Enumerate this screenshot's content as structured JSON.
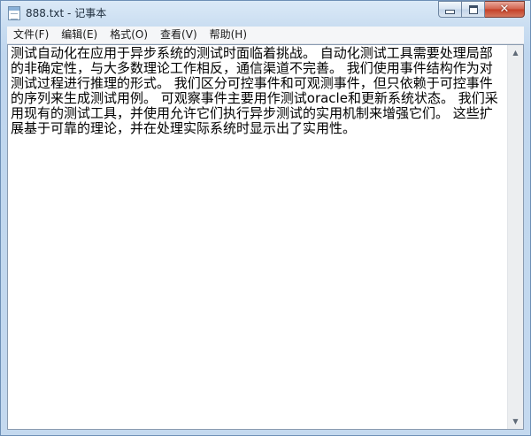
{
  "window": {
    "title": "888.txt - 记事本",
    "controls": {
      "minimize_icon": "minimize-icon",
      "maximize_icon": "maximize-icon",
      "close_icon": "close-icon",
      "close_glyph": "✕"
    }
  },
  "menu": {
    "items": [
      {
        "label": "文件(F)"
      },
      {
        "label": "编辑(E)"
      },
      {
        "label": "格式(O)"
      },
      {
        "label": "查看(V)"
      },
      {
        "label": "帮助(H)"
      }
    ]
  },
  "editor": {
    "content": "测试自动化在应用于异步系统的测试时面临着挑战。 自动化测试工具需要处理局部的非确定性，与大多数理论工作相反，通信渠道不完善。 我们使用事件结构作为对测试过程进行推理的形式。 我们区分可控事件和可观测事件，但只依赖于可控事件的序列来生成测试用例。 可观察事件主要用作测试oracle和更新系统状态。 我们采用现有的测试工具，并使用允许它们执行异步测试的实用机制来增强它们。 这些扩展基于可靠的理论，并在处理实际系统时显示出了实用性。"
  },
  "scrollbar": {
    "up_glyph": "▲",
    "down_glyph": "▼"
  },
  "colors": {
    "frame": "#c4d9ef",
    "close_button": "#c43e25",
    "menubar": "#f5f6f8",
    "editor_bg": "#ffffff"
  }
}
